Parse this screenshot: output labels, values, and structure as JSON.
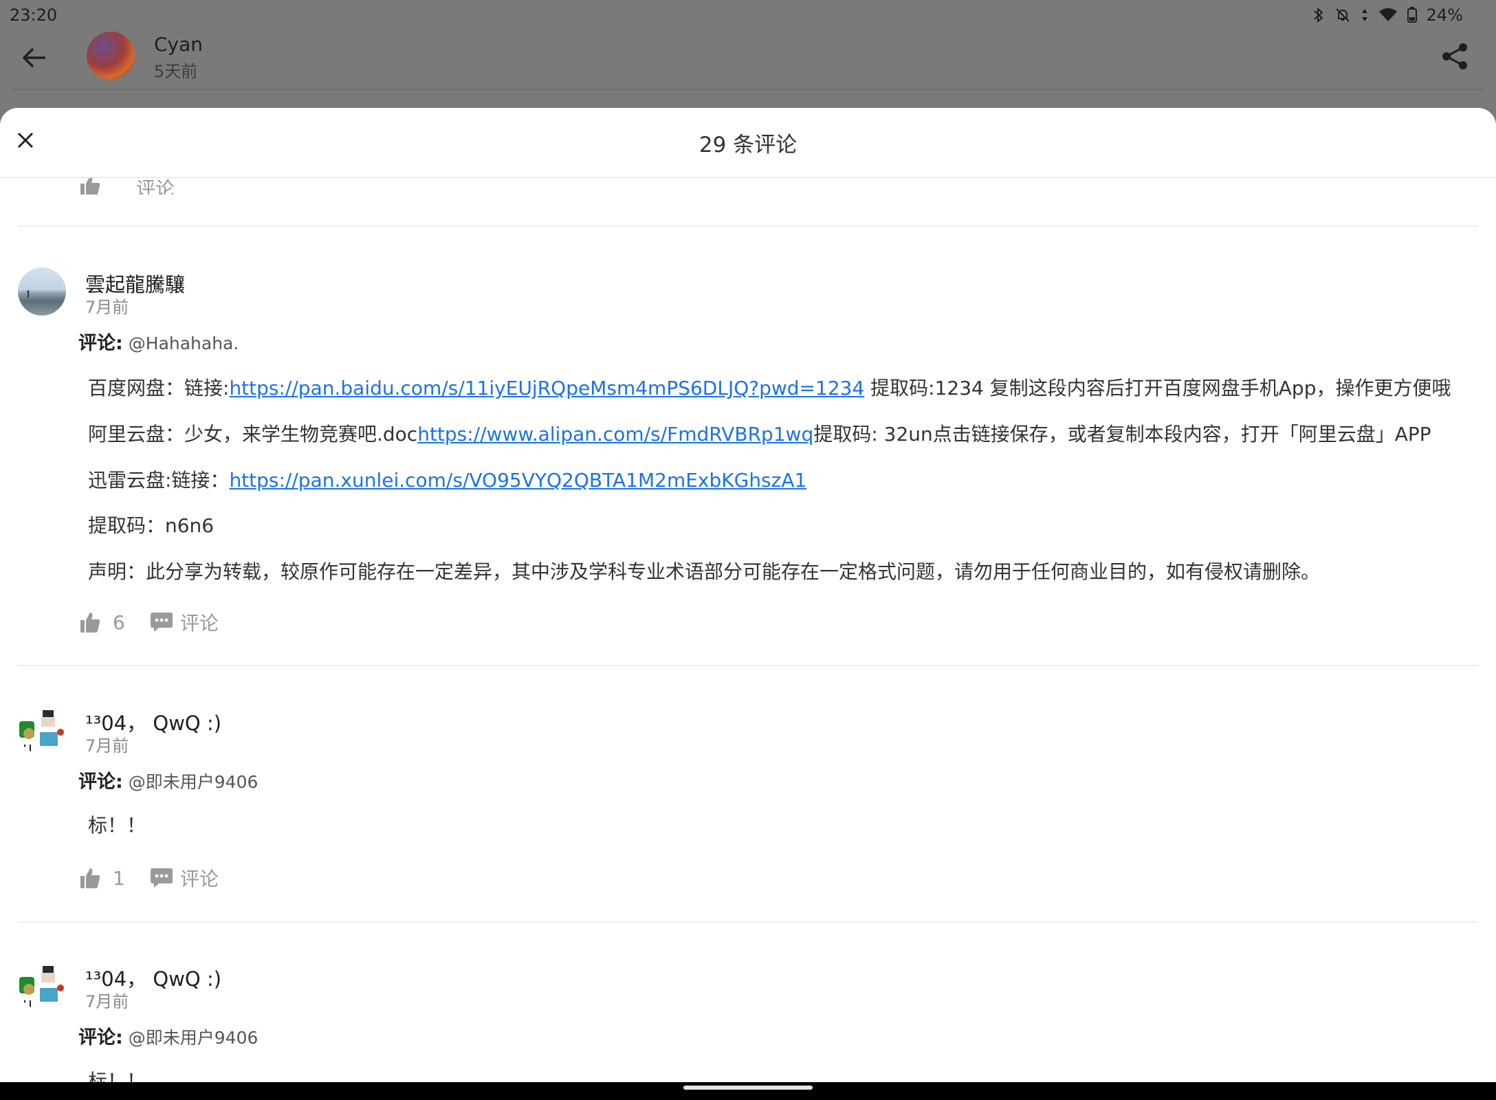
{
  "status": {
    "time": "23:20",
    "battery": "24%"
  },
  "post": {
    "author": "Cyan",
    "ago": "5天前"
  },
  "sheet": {
    "title": "29 条评论"
  },
  "partial": {
    "comment_label": "评论"
  },
  "comments": [
    {
      "name": "雲起龍騰驤",
      "time": "7月前",
      "reply_label": "评论:",
      "reply_to": "@Hahahaha.",
      "p1_prefix": "百度网盘：链接:",
      "p1_link": "https://pan.baidu.com/s/11iyEUjRQpeMsm4mPS6DLJQ?pwd=1234",
      "p1_suffix": " 提取码:1234 复制这段内容后打开百度网盘手机App，操作更方便哦",
      "p2_prefix": "阿里云盘：少女，来学生物竞赛吧.doc",
      "p2_link": "https://www.alipan.com/s/FmdRVBRp1wq",
      "p2_suffix": "提取码: 32un点击链接保存，或者复制本段内容，打开「阿里云盘」APP",
      "p3_prefix": "迅雷云盘:链接：",
      "p3_link": "https://pan.xunlei.com/s/VO95VYQ2QBTA1M2mExbKGhszA1",
      "p4": "提取码：n6n6",
      "p5": "声明：此分享为转载，较原作可能存在一定差异，其中涉及学科专业术语部分可能存在一定格式问题，请勿用于任何商业目的，如有侵权请删除。",
      "likes": "6",
      "comment_label": "评论"
    },
    {
      "name": "¹³04，  QwQ   :)",
      "time": "7月前",
      "reply_label": "评论:",
      "reply_to": "@即未用户9406",
      "text": "标！！",
      "likes": "1",
      "comment_label": "评论"
    },
    {
      "name": "¹³04，  QwQ   :)",
      "time": "7月前",
      "reply_label": "评论:",
      "reply_to": "@即未用户9406",
      "text": "标！！"
    }
  ],
  "colors": {
    "link": "#1a73e8",
    "scrim": "#7a7a7a",
    "muted": "#9a9a9a"
  }
}
